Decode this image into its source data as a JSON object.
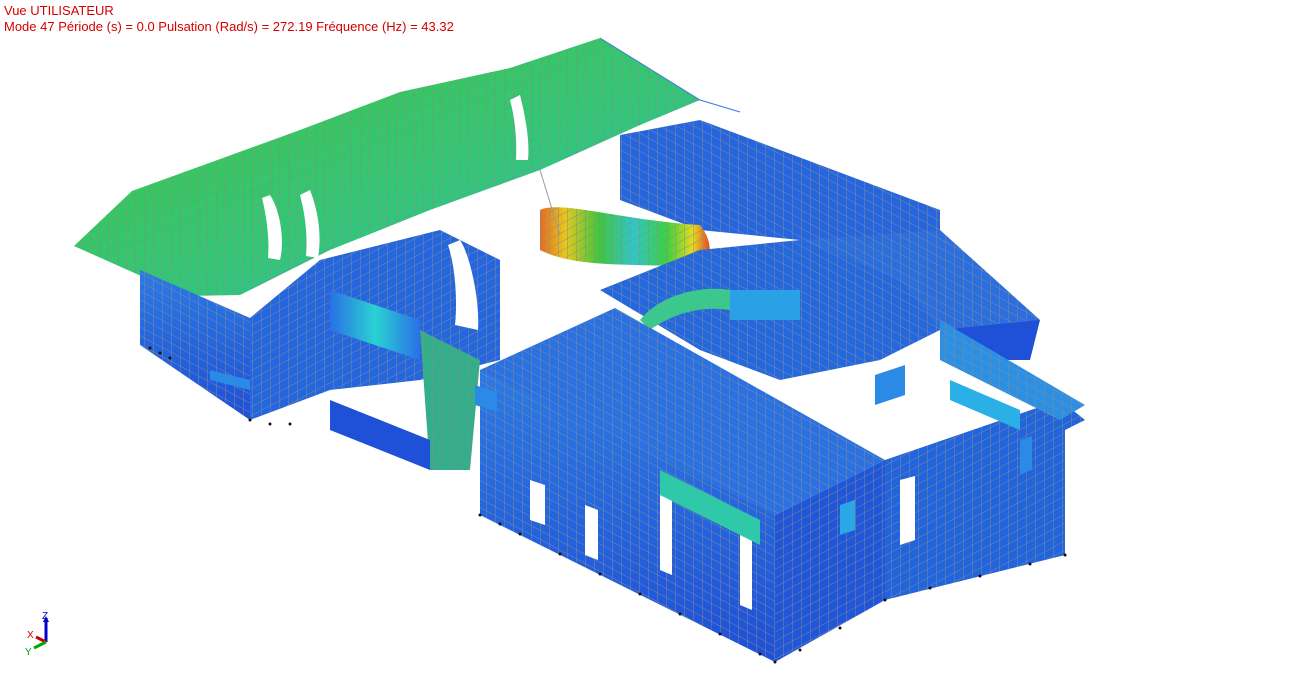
{
  "view": {
    "title": "Vue UTILISATEUR",
    "mode_line": "Mode 47  Période (s) = 0.0  Pulsation (Rad/s) = 272.19  Fréquence (Hz) = 43.32"
  },
  "triad": {
    "z_label": "Z",
    "x_label": "X",
    "y_label": "Y",
    "z_color": "#0000cc",
    "x_color": "#cc0000",
    "y_color": "#00aa00"
  },
  "colors": {
    "hud_text": "#d40000",
    "mesh_line": "#888888",
    "low_displacement": "#1e5fe6",
    "mid_displacement": "#2dd2c8",
    "high_displacement": "#3cc83c",
    "peak_displacement": "#e63c1e"
  }
}
